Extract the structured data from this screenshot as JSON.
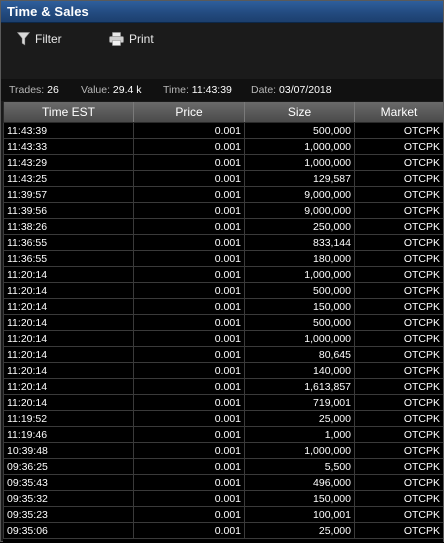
{
  "window": {
    "title": "Time & Sales"
  },
  "toolbar": {
    "filter_label": "Filter",
    "print_label": "Print"
  },
  "info": {
    "trades_label": "Trades:",
    "trades_value": "26",
    "value_label": "Value:",
    "value_value": "29.4 k",
    "time_label": "Time:",
    "time_value": "11:43:39",
    "date_label": "Date:",
    "date_value": "03/07/2018"
  },
  "table": {
    "columns": [
      "Time EST",
      "Price",
      "Size",
      "Market"
    ],
    "rows": [
      [
        "11:43:39",
        "0.001",
        "500,000",
        "OTCPK"
      ],
      [
        "11:43:33",
        "0.001",
        "1,000,000",
        "OTCPK"
      ],
      [
        "11:43:29",
        "0.001",
        "1,000,000",
        "OTCPK"
      ],
      [
        "11:43:25",
        "0.001",
        "129,587",
        "OTCPK"
      ],
      [
        "11:39:57",
        "0.001",
        "9,000,000",
        "OTCPK"
      ],
      [
        "11:39:56",
        "0.001",
        "9,000,000",
        "OTCPK"
      ],
      [
        "11:38:26",
        "0.001",
        "250,000",
        "OTCPK"
      ],
      [
        "11:36:55",
        "0.001",
        "833,144",
        "OTCPK"
      ],
      [
        "11:36:55",
        "0.001",
        "180,000",
        "OTCPK"
      ],
      [
        "11:20:14",
        "0.001",
        "1,000,000",
        "OTCPK"
      ],
      [
        "11:20:14",
        "0.001",
        "500,000",
        "OTCPK"
      ],
      [
        "11:20:14",
        "0.001",
        "150,000",
        "OTCPK"
      ],
      [
        "11:20:14",
        "0.001",
        "500,000",
        "OTCPK"
      ],
      [
        "11:20:14",
        "0.001",
        "1,000,000",
        "OTCPK"
      ],
      [
        "11:20:14",
        "0.001",
        "80,645",
        "OTCPK"
      ],
      [
        "11:20:14",
        "0.001",
        "140,000",
        "OTCPK"
      ],
      [
        "11:20:14",
        "0.001",
        "1,613,857",
        "OTCPK"
      ],
      [
        "11:20:14",
        "0.001",
        "719,001",
        "OTCPK"
      ],
      [
        "11:19:52",
        "0.001",
        "25,000",
        "OTCPK"
      ],
      [
        "11:19:46",
        "0.001",
        "1,000",
        "OTCPK"
      ],
      [
        "10:39:48",
        "0.001",
        "1,000,000",
        "OTCPK"
      ],
      [
        "09:36:25",
        "0.001",
        "5,500",
        "OTCPK"
      ],
      [
        "09:35:43",
        "0.001",
        "496,000",
        "OTCPK"
      ],
      [
        "09:35:32",
        "0.001",
        "150,000",
        "OTCPK"
      ],
      [
        "09:35:23",
        "0.001",
        "100,001",
        "OTCPK"
      ],
      [
        "09:35:06",
        "0.001",
        "25,000",
        "OTCPK"
      ]
    ]
  },
  "icons": {
    "filter": "filter-funnel-icon",
    "print": "printer-icon"
  }
}
